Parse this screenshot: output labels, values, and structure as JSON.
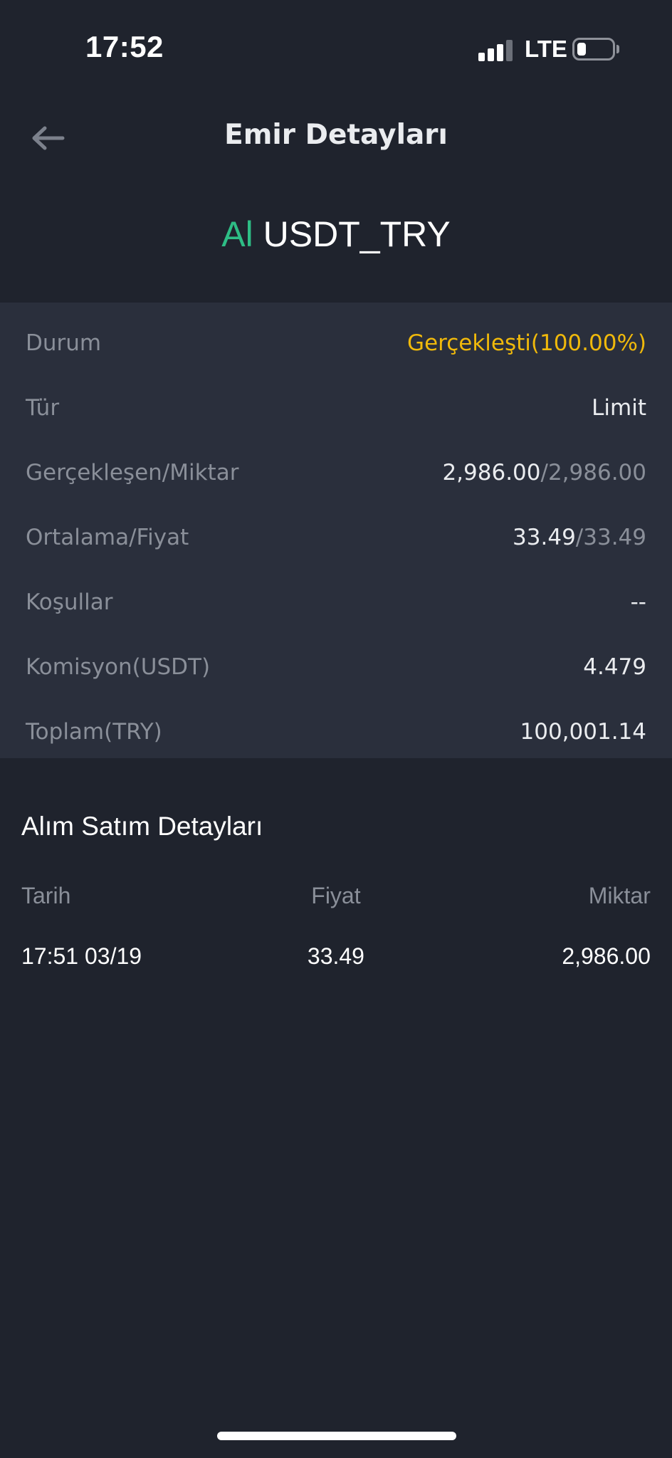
{
  "status_bar": {
    "time": "17:52",
    "network": "LTE"
  },
  "header": {
    "title": "Emir Detayları",
    "back_icon": "arrow-left-icon"
  },
  "order": {
    "side": "Al",
    "pair": "USDT_TRY",
    "side_color": "#2ebd85"
  },
  "details": {
    "status": {
      "label": "Durum",
      "value": "Gerçekleşti(100.00%)",
      "color": "#f0b90b"
    },
    "type": {
      "label": "Tür",
      "value": "Limit"
    },
    "filled": {
      "label": "Gerçekleşen/Miktar",
      "filled": "2,986.00",
      "amount": "/2,986.00"
    },
    "price": {
      "label": "Ortalama/Fiyat",
      "average": "33.49",
      "price": "/33.49"
    },
    "conditions": {
      "label": "Koşullar",
      "value": "--"
    },
    "fee": {
      "label": "Komisyon(USDT)",
      "value": "4.479"
    },
    "total": {
      "label": "Toplam(TRY)",
      "value": "100,001.14"
    }
  },
  "trades": {
    "title": "Alım Satım Detayları",
    "columns": [
      "Tarih",
      "Fiyat",
      "Miktar"
    ],
    "rows": [
      {
        "date": "17:51 03/19",
        "price": "33.49",
        "amount": "2,986.00"
      }
    ]
  }
}
